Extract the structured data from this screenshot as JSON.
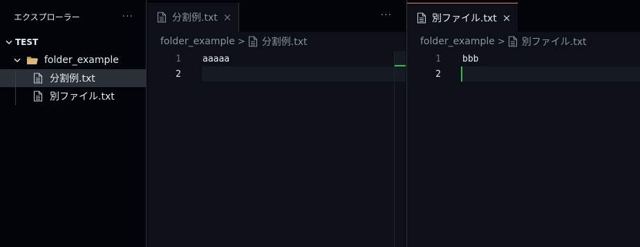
{
  "sidebar": {
    "title": "エクスプローラー",
    "more_label": "···",
    "root": "TEST",
    "folder": "folder_example",
    "files": [
      {
        "name": "分割例.txt",
        "selected": true
      },
      {
        "name": "別ファイル.txt",
        "selected": false
      }
    ]
  },
  "left_group": {
    "tab": {
      "label": "分割例.txt",
      "close": "×"
    },
    "more_label": "···",
    "breadcrumb": {
      "folder": "folder_example",
      "sep": ">",
      "file": "分割例.txt"
    },
    "lines": [
      {
        "number": "1",
        "text": "aaaaa"
      },
      {
        "number": "2",
        "text": ""
      }
    ]
  },
  "right_group": {
    "tab": {
      "label": "別ファイル.txt",
      "close": "×"
    },
    "breadcrumb": {
      "folder": "folder_example",
      "sep": ">",
      "file": "別ファイル.txt"
    },
    "lines": [
      {
        "number": "1",
        "text": "bbb"
      },
      {
        "number": "2",
        "text": ""
      }
    ]
  },
  "colors": {
    "accent_tab_border": "#f78166",
    "cursor": "#3fb950",
    "background": "#0d1117"
  }
}
